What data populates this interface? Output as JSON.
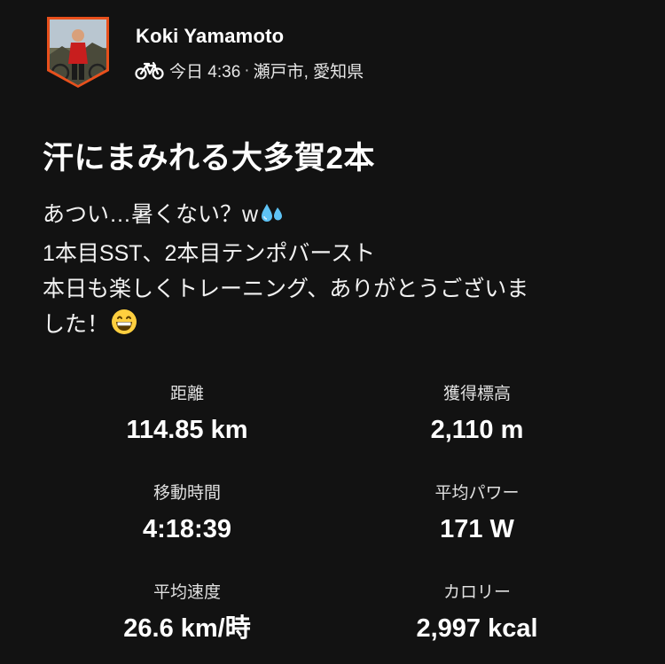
{
  "athlete": {
    "name": "Koki Yamamoto",
    "activity_icon": "bike-icon",
    "time": "今日 4:36",
    "separator": "·",
    "location": "瀬戸市, 愛知県"
  },
  "activity": {
    "title": "汗にまみれる大多賀2本",
    "description_lines": [
      "あつい…暑くない？w",
      "1本目SST、2本目テンポバースト",
      "本日も楽しくトレーニング、ありがとうございま",
      "した！"
    ],
    "emojis": [
      "sweat-droplets-emoji",
      "grinning-face-emoji"
    ]
  },
  "stats": [
    {
      "label": "距離",
      "value": "114.85 km"
    },
    {
      "label": "獲得標高",
      "value": "2,110 m"
    },
    {
      "label": "移動時間",
      "value": "4:18:39"
    },
    {
      "label": "平均パワー",
      "value": "171 W"
    },
    {
      "label": "平均速度",
      "value": "26.6 km/時"
    },
    {
      "label": "カロリー",
      "value": "2,997 kcal"
    }
  ],
  "colors": {
    "background": "#121212",
    "avatar_frame": "#e8501c",
    "text": "#ffffff"
  }
}
